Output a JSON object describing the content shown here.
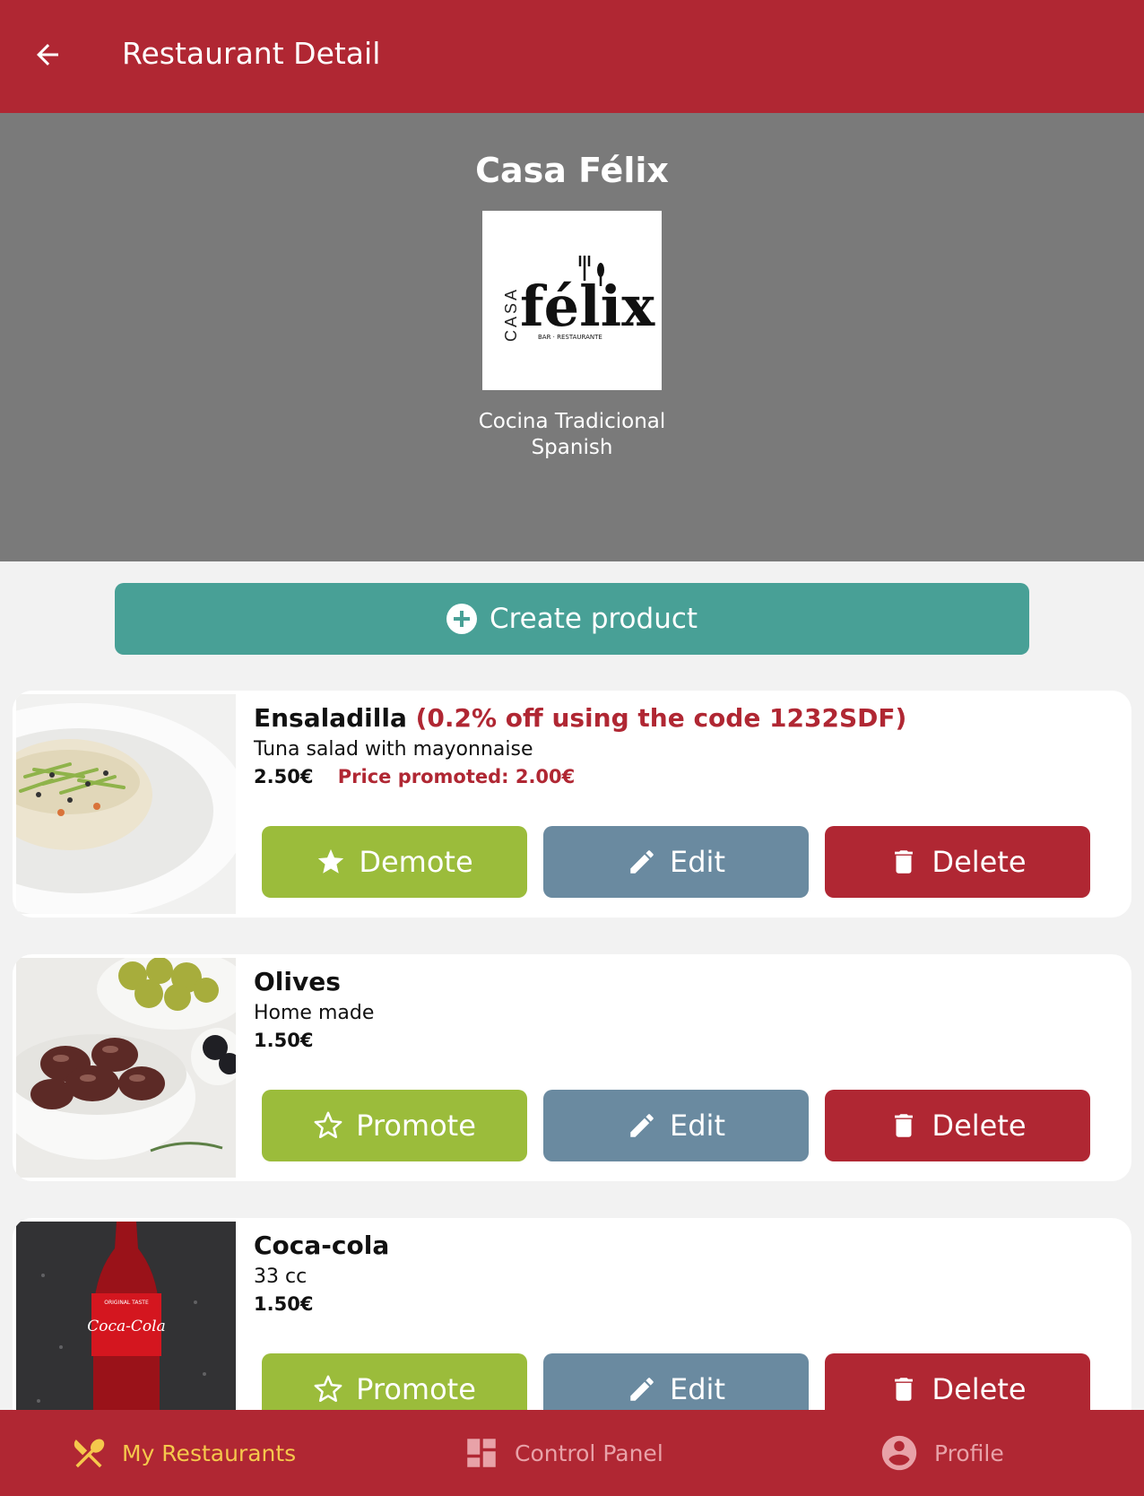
{
  "appbar": {
    "title": "Restaurant Detail",
    "back_icon": "arrow-left-icon"
  },
  "restaurant": {
    "name": "Casa Félix",
    "logo": {
      "brand": "félix",
      "vertical_word": "CASA",
      "tagline": "BAR · RESTAURANTE"
    },
    "description": "Cocina Tradicional",
    "category": "Spanish"
  },
  "create_button": {
    "label": "Create product",
    "icon": "plus-circle-icon"
  },
  "products": [
    {
      "name": "Ensaladilla",
      "promo": "(0.2% off using the code 1232SDF)",
      "description": "Tuna salad with mayonnaise",
      "price": "2.50€",
      "promoted_price": "Price promoted: 2.00€",
      "promote_label": "Demote",
      "promote_icon": "star-filled-icon",
      "edit_label": "Edit",
      "delete_label": "Delete"
    },
    {
      "name": "Olives",
      "description": "Home made",
      "price": "1.50€",
      "promote_label": "Promote",
      "promote_icon": "star-outline-icon",
      "edit_label": "Edit",
      "delete_label": "Delete"
    },
    {
      "name": "Coca-cola",
      "description": "33 cc",
      "price": "1.50€",
      "image_text": {
        "bottle_label": "Coca-Cola",
        "small_label": "ORIGINAL TASTE"
      },
      "promote_label": "Promote",
      "promote_icon": "star-outline-icon",
      "edit_label": "Edit",
      "delete_label": "Delete"
    }
  ],
  "bottom_nav": [
    {
      "label": "My Restaurants",
      "icon": "fork-knife-icon",
      "active": true
    },
    {
      "label": "Control Panel",
      "icon": "dashboard-icon",
      "active": false
    },
    {
      "label": "Profile",
      "icon": "account-circle-icon",
      "active": false
    }
  ],
  "colors": {
    "primary": "#b02733",
    "hero_bg": "#7a7a7a",
    "create_button": "#48a096",
    "promote_button": "#9bbc3b",
    "edit_button": "#6a8aa0",
    "delete_button": "#b02733",
    "nav_active": "#f5c84c"
  }
}
